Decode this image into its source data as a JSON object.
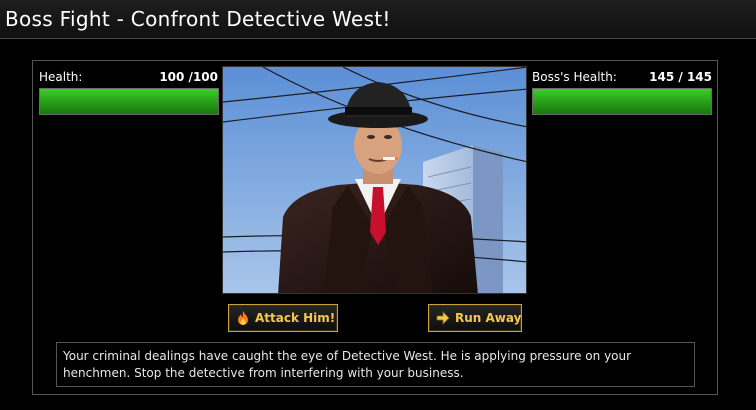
{
  "title": "Boss Fight - Confront Detective West!",
  "player": {
    "label": "Health:",
    "value_text": "100 /100",
    "current": 100,
    "max": 100
  },
  "boss": {
    "label": "Boss's Health:",
    "value_text": "145 / 145",
    "current": 145,
    "max": 145
  },
  "portrait": {
    "icon": "detective-west-portrait"
  },
  "buttons": {
    "attack": {
      "label": "Attack Him!",
      "icon": "fire-icon"
    },
    "run": {
      "label": "Run Away",
      "icon": "arrow-right-icon"
    }
  },
  "description": "Your criminal dealings have caught the eye of Detective West. He is applying pressure on your henchmen. Stop the detective from interfering with your business.",
  "colors": {
    "health_bar": "#2aa51a",
    "button_text": "#f2c94c",
    "button_border": "#c9a33a"
  }
}
